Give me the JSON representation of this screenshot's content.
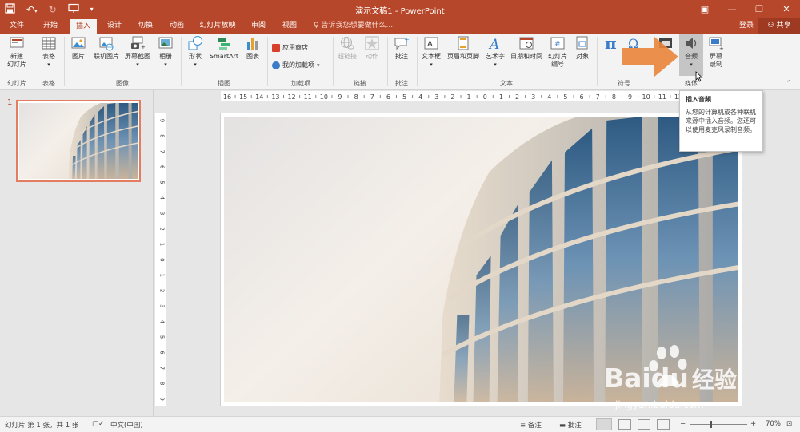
{
  "window": {
    "title": "演示文稿1 - PowerPoint"
  },
  "tabs": [
    "文件",
    "开始",
    "插入",
    "设计",
    "切换",
    "动画",
    "幻灯片放映",
    "审阅",
    "视图"
  ],
  "active_tab": "插入",
  "tell_me": "告诉我您想要做什么...",
  "account": {
    "login": "登录",
    "share": "共享"
  },
  "ribbon": {
    "new_slide": "新建\n幻灯片",
    "table": "表格",
    "picture": "图片",
    "online_picture": "联机图片",
    "screenshot": "屏幕截图",
    "album": "相册",
    "shapes": "形状",
    "smartart": "SmartArt",
    "chart": "图表",
    "store": "应用商店",
    "my_addins": "我的加载项",
    "hyperlink": "超链接",
    "action": "动作",
    "comment": "批注",
    "textbox": "文本框",
    "header_footer": "页眉和页脚",
    "wordart": "艺术字",
    "datetime": "日期和时间",
    "slide_number": "幻灯片\n编号",
    "object": "对象",
    "audio": "音频",
    "screen_record": "屏幕\n录制"
  },
  "groups": {
    "slides": "幻灯片",
    "tables": "表格",
    "images": "图像",
    "illustrations": "插图",
    "addins": "加载项",
    "links": "链接",
    "comments": "批注",
    "text": "文本",
    "symbols": "符号",
    "media": "媒体"
  },
  "tooltip": {
    "title": "插入音频",
    "body": "从您的计算机或各种联机来源中插入音频。您还可以使用麦克风录制音频。"
  },
  "slide_panel": {
    "number": "1"
  },
  "statusbar": {
    "slide_info": "幻灯片 第 1 张，共 1 张",
    "language": "中文(中国)",
    "notes": "备注",
    "comments": "批注",
    "zoom": "70%"
  },
  "ruler": {
    "h_ticks": [
      "16",
      "15",
      "14",
      "13",
      "12",
      "11",
      "10",
      "9",
      "8",
      "7",
      "6",
      "5",
      "4",
      "3",
      "2",
      "1",
      "0",
      "1",
      "2",
      "3",
      "4",
      "5",
      "6",
      "7",
      "8",
      "9",
      "10",
      "11",
      "12"
    ],
    "v_ticks": [
      "9",
      "8",
      "7",
      "6",
      "5",
      "4",
      "3",
      "2",
      "1",
      "0",
      "1",
      "2",
      "3",
      "4",
      "5",
      "6",
      "7",
      "8",
      "9"
    ]
  },
  "watermark": {
    "brand": "Baidu",
    "brand_cn": "经验",
    "url": "jingyan.baidu.com"
  },
  "colors": {
    "accent": "#b7472a",
    "ribbon_bg": "#f3f3f3",
    "arrow": "#e9853a"
  }
}
